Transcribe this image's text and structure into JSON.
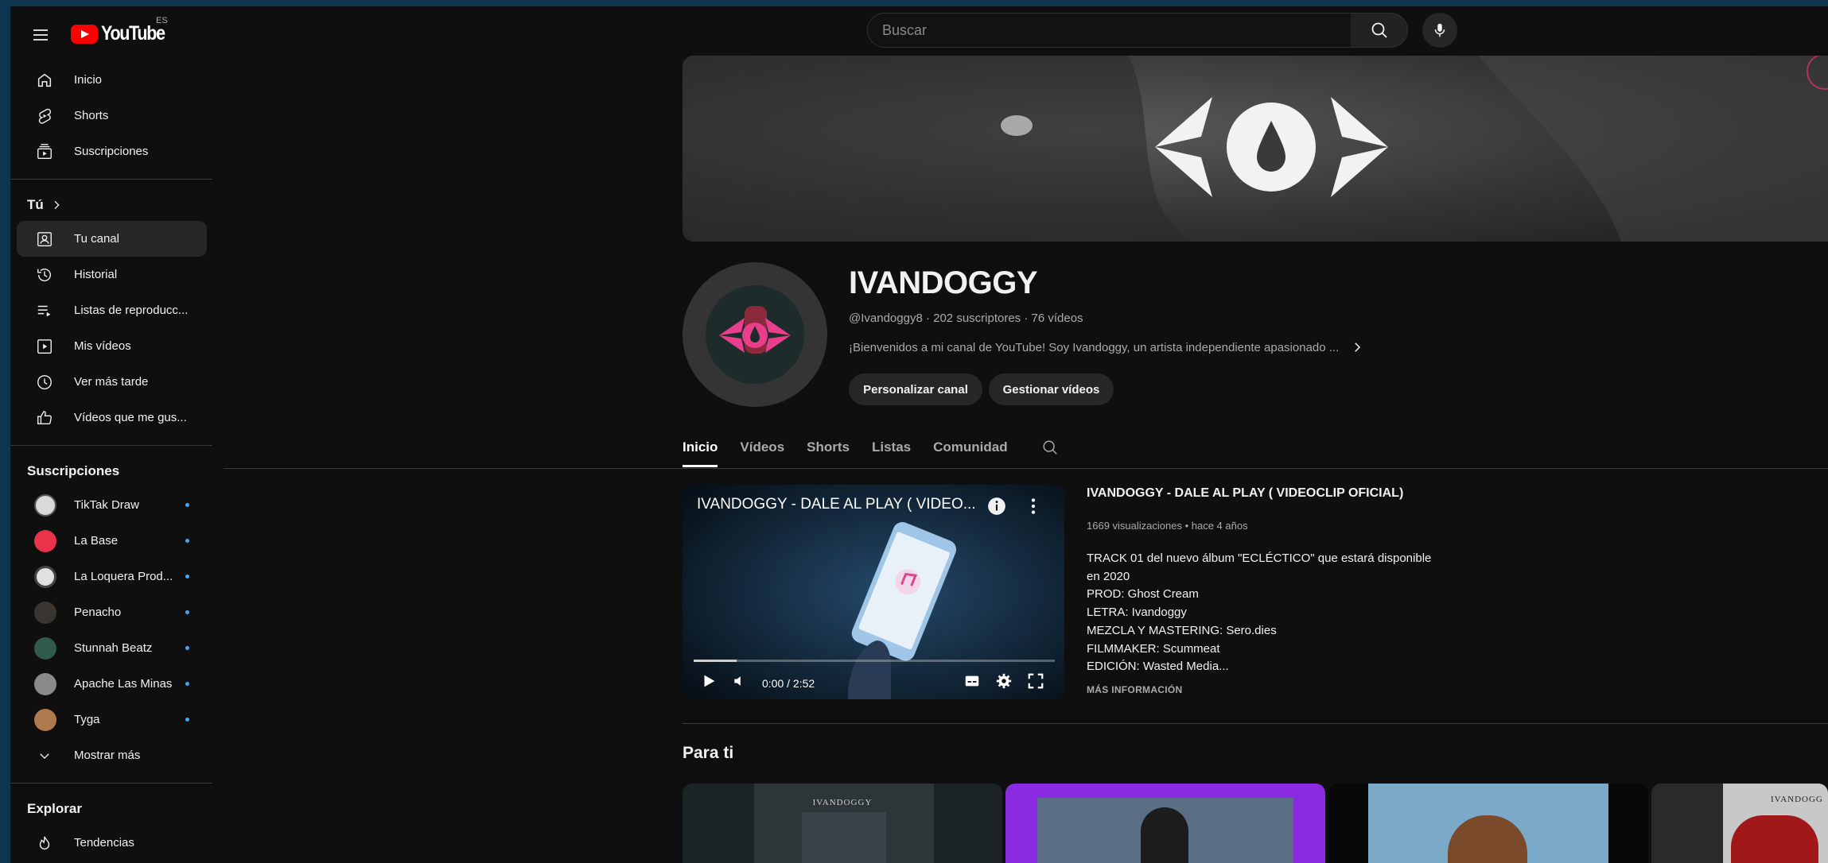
{
  "header": {
    "logo_text": "YouTube",
    "country_code": "ES",
    "search_placeholder": "Buscar"
  },
  "sidebar": {
    "main": [
      {
        "label": "Inicio",
        "icon": "home-icon"
      },
      {
        "label": "Shorts",
        "icon": "shorts-icon"
      },
      {
        "label": "Suscripciones",
        "icon": "subscriptions-icon"
      }
    ],
    "you_heading": "Tú",
    "you": [
      {
        "label": "Tu canal",
        "icon": "your-channel-icon",
        "active": true
      },
      {
        "label": "Historial",
        "icon": "history-icon"
      },
      {
        "label": "Listas de reproducc...",
        "icon": "playlists-icon"
      },
      {
        "label": "Mis vídeos",
        "icon": "my-videos-icon"
      },
      {
        "label": "Ver más tarde",
        "icon": "watch-later-icon"
      },
      {
        "label": "Vídeos que me gus...",
        "icon": "liked-videos-icon"
      }
    ],
    "subs_heading": "Suscripciones",
    "subscriptions": [
      {
        "label": "TikTak Draw",
        "color": "#d9d9d9"
      },
      {
        "label": "La Base",
        "color": "#e8334a"
      },
      {
        "label": "La Loquera Prod...",
        "color": "#e0e0e0"
      },
      {
        "label": "Penacho",
        "color": "#3a3530"
      },
      {
        "label": "Stunnah Beatz",
        "color": "#2f5a4c"
      },
      {
        "label": "Apache Las Minas",
        "color": "#8a8a8a"
      },
      {
        "label": "Tyga",
        "color": "#b07a4f"
      }
    ],
    "show_more": "Mostrar más",
    "explore_heading": "Explorar",
    "explore": [
      {
        "label": "Tendencias",
        "icon": "trending-icon"
      }
    ]
  },
  "channel": {
    "name": "IVANDOGGY",
    "meta": "@Ivandoggy8 · 202 suscriptores · 76 vídeos",
    "description": "¡Bienvenidos a mi canal de YouTube! Soy Ivandoggy, un artista independiente apasionado ...",
    "customize_button": "Personalizar canal",
    "manage_button": "Gestionar vídeos"
  },
  "tabs": [
    {
      "label": "Inicio",
      "active": true
    },
    {
      "label": "Vídeos",
      "active": false
    },
    {
      "label": "Shorts",
      "active": false
    },
    {
      "label": "Listas",
      "active": false
    },
    {
      "label": "Comunidad",
      "active": false
    }
  ],
  "featured": {
    "player_title": "IVANDOGGY - DALE AL PLAY ( VIDEO...",
    "time": "0:00 / 2:52",
    "progress": 0.12,
    "title": "IVANDOGGY - DALE AL PLAY ( VIDEOCLIP OFICIAL)",
    "stats": "1669 visualizaciones • hace 4 años",
    "description_lines": [
      "TRACK 01 del nuevo álbum  \"ECLÉCTICO\"  que estará disponible",
      "en 2020",
      "PROD: Ghost Cream",
      "LETRA: Ivandoggy",
      "MEZCLA Y MASTERING: Sero.dies",
      "FILMMAKER: Scummeat",
      "EDICIÓN: Wasted Media..."
    ],
    "more_info": "MÁS INFORMACIÓN"
  },
  "for_you": {
    "title": "Para ti",
    "thumb_label_1": "IVANDOGGY",
    "thumb_label_4": "IVANDOGG"
  }
}
